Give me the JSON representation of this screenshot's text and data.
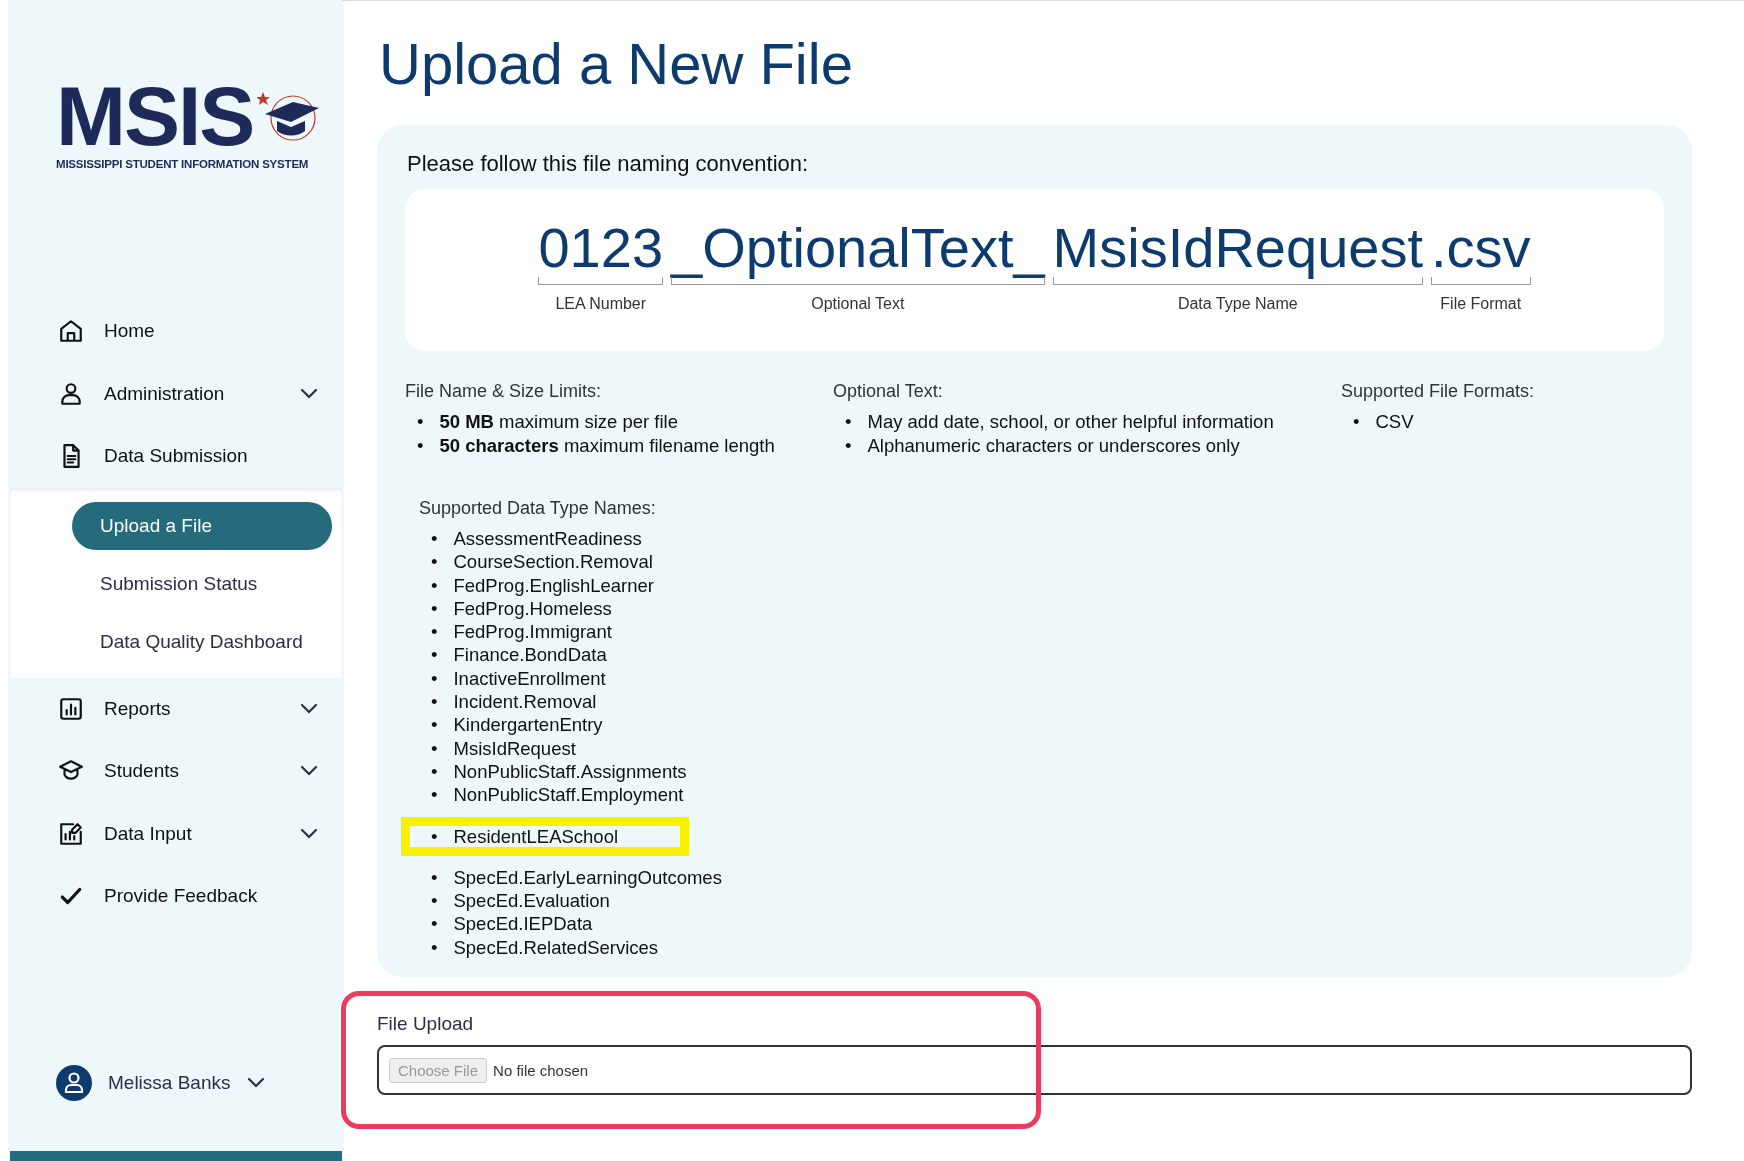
{
  "logo": {
    "title": "MSIS",
    "subtitle": "MISSISSIPPI STUDENT INFORMATION SYSTEM"
  },
  "sidebar": {
    "items": [
      {
        "label": "Home",
        "chevron": false
      },
      {
        "label": "Administration",
        "chevron": true
      },
      {
        "label": "Data Submission",
        "chevron": false,
        "children": [
          {
            "label": "Upload a File",
            "selected": true
          },
          {
            "label": "Submission Status",
            "selected": false
          },
          {
            "label": "Data Quality Dashboard",
            "selected": false
          }
        ]
      },
      {
        "label": "Reports",
        "chevron": true
      },
      {
        "label": "Students",
        "chevron": true
      },
      {
        "label": "Data Input",
        "chevron": true
      },
      {
        "label": "Provide Feedback",
        "chevron": false
      }
    ],
    "user": {
      "name": "Melissa Banks"
    }
  },
  "page_title": "Upload a New File",
  "convention": {
    "heading": "Please follow this file naming convention:",
    "parts": [
      {
        "text": "0123",
        "label": "LEA Number"
      },
      {
        "text": "_OptionalText_",
        "label": "Optional Text"
      },
      {
        "text": "MsisIdRequest",
        "label": "Data Type Name"
      },
      {
        "text": ".csv",
        "label": "File Format"
      }
    ]
  },
  "bullet": "•",
  "rules": [
    {
      "heading": "File Name & Size Limits:",
      "items": [
        "**50 MB** maximum size per file",
        "**50 characters** maximum filename length"
      ]
    },
    {
      "heading": "Optional Text:",
      "items": [
        "May add date, school, or other helpful information",
        "Alphanumeric characters or underscores only"
      ]
    },
    {
      "heading": "Supported File Formats:",
      "items": [
        "CSV"
      ]
    }
  ],
  "data_types": {
    "heading": "Supported Data Type Names:",
    "items": [
      {
        "label": "AssessmentReadiness",
        "highlighted": false
      },
      {
        "label": "CourseSection.Removal",
        "highlighted": false
      },
      {
        "label": "FedProg.EnglishLearner",
        "highlighted": false
      },
      {
        "label": "FedProg.Homeless",
        "highlighted": false
      },
      {
        "label": "FedProg.Immigrant",
        "highlighted": false
      },
      {
        "label": "Finance.BondData",
        "highlighted": false
      },
      {
        "label": "InactiveEnrollment",
        "highlighted": false
      },
      {
        "label": "Incident.Removal",
        "highlighted": false
      },
      {
        "label": "KindergartenEntry",
        "highlighted": false
      },
      {
        "label": "MsisIdRequest",
        "highlighted": false
      },
      {
        "label": "NonPublicStaff.Assignments",
        "highlighted": false
      },
      {
        "label": "NonPublicStaff.Employment",
        "highlighted": false
      },
      {
        "label": "ResidentLEASchool",
        "highlighted": true
      },
      {
        "label": "SpecEd.EarlyLearningOutcomes",
        "highlighted": false
      },
      {
        "label": "SpecEd.Evaluation",
        "highlighted": false
      },
      {
        "label": "SpecEd.IEPData",
        "highlighted": false
      },
      {
        "label": "SpecEd.RelatedServices",
        "highlighted": false
      }
    ]
  },
  "upload": {
    "label": "File Upload",
    "button": "Choose File",
    "status": "No file chosen",
    "highlighted": true
  }
}
